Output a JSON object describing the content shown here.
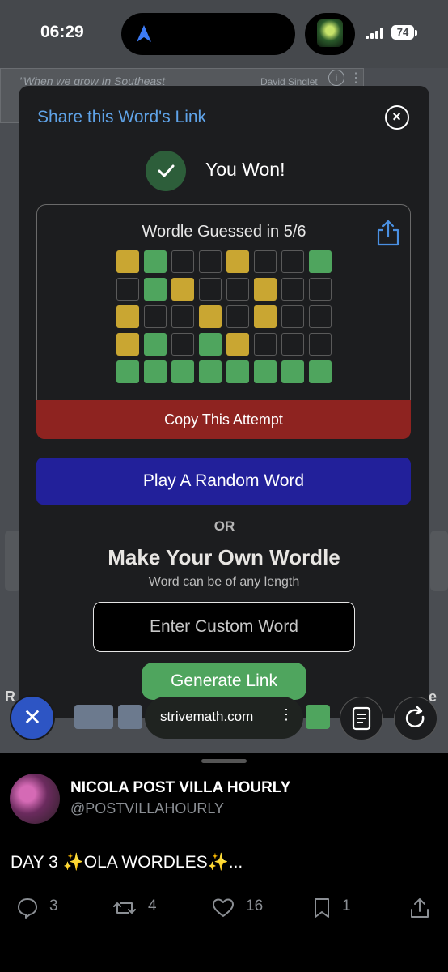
{
  "status_bar": {
    "time": "06:29",
    "battery": "74"
  },
  "ad": {
    "text": "\"When we grow In Southeast",
    "author": "David Singlet",
    "info": "i",
    "menu": "⋮"
  },
  "modal": {
    "share_link": "Share this Word's Link",
    "close_glyph": "×",
    "won_text": "You Won!",
    "result_title": "Wordle Guessed in 5/6",
    "grid": [
      [
        "y",
        "g",
        "b",
        "b",
        "y",
        "b",
        "b",
        "g"
      ],
      [
        "b",
        "g",
        "y",
        "b",
        "b",
        "y",
        "b",
        "b"
      ],
      [
        "y",
        "b",
        "b",
        "y",
        "b",
        "y",
        "b",
        "b"
      ],
      [
        "y",
        "g",
        "b",
        "g",
        "y",
        "b",
        "b",
        "b"
      ],
      [
        "g",
        "g",
        "g",
        "g",
        "g",
        "g",
        "g",
        "g"
      ]
    ],
    "copy_button": "Copy This Attempt",
    "random_button": "Play A Random Word",
    "or_text": "OR",
    "make_title": "Make Your Own Wordle",
    "make_subtitle": "Word can be of any length",
    "custom_placeholder": "Enter Custom Word",
    "generate_button": "Generate Link"
  },
  "colors": {
    "yellow": "#c9a632",
    "green": "#4fa55e",
    "red": "#8e2320",
    "blue": "#22209a",
    "link": "#5fa3e8"
  },
  "browser": {
    "url": "strivemath.com",
    "menu": "⋮",
    "close_glyph": "✕",
    "edge_left": "R",
    "edge_right": "e"
  },
  "tweet": {
    "display_name": "NICOLA POST VILLA HOURLY",
    "handle": "@POSTVILLAHOURLY",
    "text": "DAY 3 ✨OLA WORDLES✨...",
    "replies": "3",
    "retweets": "4",
    "likes": "16",
    "bookmarks": "1"
  }
}
